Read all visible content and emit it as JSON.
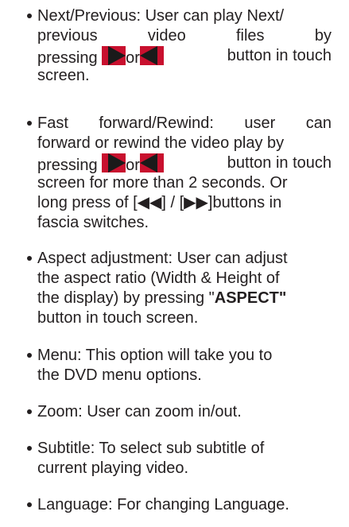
{
  "colors": {
    "text": "#231f20",
    "button_red": "#c8102e",
    "button_dark": "#1a1a1a"
  },
  "icons": {
    "next": "next-button-icon",
    "previous": "previous-button-icon"
  },
  "items": [
    {
      "l1": "Next/Previous: User can play Next/",
      "l2": [
        "previous",
        "video",
        "files",
        "by"
      ],
      "l3": {
        "a": "pressing",
        "b": "or",
        "c": "button in touch"
      },
      "l4": "screen."
    },
    {
      "l1": [
        "Fast",
        "forward/Rewind:",
        "user",
        "can"
      ],
      "l2": "forward or rewind the video play by",
      "l3": {
        "a": "pressing",
        "b": "or",
        "c": "button in touch"
      },
      "l4": "screen for more than 2 seconds. Or",
      "l5": "long press of [◀◀] / [▶▶]buttons in",
      "l6": "fascia switches."
    },
    {
      "l1": "Aspect adjustment: User can adjust",
      "l2": "the aspect ratio (Width & Height of",
      "l3": {
        "a": "the display) by pressing \"",
        "b": "ASPECT\""
      },
      "l4": "button in touch screen."
    },
    {
      "l1": "Menu: This option will take you to",
      "l2": "the DVD menu options."
    },
    {
      "l1": "Zoom: User can zoom in/out."
    },
    {
      "l1": "Subtitle: To select sub subtitle of",
      "l2": "current playing video."
    },
    {
      "l1": "Language: For changing Language."
    }
  ]
}
